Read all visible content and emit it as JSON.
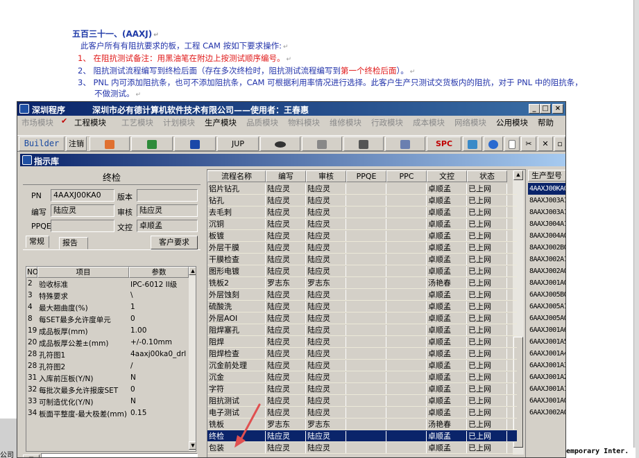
{
  "doc": {
    "heading": "五百三十一、(AAXJ)",
    "intro": "此客户所有有阻抗要求的板，工程 CAM 按如下要求操作:",
    "item1_prefix": "1、 在阻抗测试备注：",
    "item1_red": "用黑油笔在附边上按测试顺序编号。",
    "item2_prefix": "2、 阻抗测试流程编写到终检后面（存在多次终检时，阻抗测试流程编写到",
    "item2_red": "第一个终检后面",
    "item2_suffix": "）。",
    "item3": "3、 PNL 内可添加阻抗条，也可不添加阻抗条，CAM 可根据利用率情况进行选择。此客户生产只测试交货板内的阻抗，对于 PNL 中的阻抗条，",
    "item3_cont": "不做测试。"
  },
  "left_edge_text": "公司",
  "status_right": "emporary Inter.",
  "window": {
    "title": "深圳程序",
    "company": "深圳市必有德计算机软件技术有限公司——使用者：王春惠",
    "menus": [
      "市场模块",
      "工程模块",
      "工艺模块",
      "计划模块",
      "生产模块",
      "品质模块",
      "物料模块",
      "维修模块",
      "行政模块",
      "成本模块",
      "网络模块",
      "公用模块",
      "帮助"
    ],
    "toolbar": [
      "Builder",
      "注销",
      "JUP",
      "SPC"
    ]
  },
  "dialog": {
    "title": "指示库",
    "panel_title": "终检",
    "pn_label": "PN",
    "pn_value": "4AAXJ00KA0",
    "version_label": "版本",
    "version_value": "",
    "author_label": "编写",
    "author_value": "陆应灵",
    "reviewer_label": "审核",
    "reviewer_value": "陆应灵",
    "ppqe_label": "PPQE",
    "ppqe_value": "",
    "doc_ctrl_label": "文控",
    "doc_ctrl_value": "卓顺孟",
    "tabs": [
      "常规",
      "报告"
    ],
    "customer_btn": "客户要求",
    "params_headers": [
      "NO",
      "项目",
      "参数"
    ],
    "params": [
      {
        "no": "2",
        "item": "验收标准",
        "value": "IPC-6012 II级"
      },
      {
        "no": "3",
        "item": "特殊要求",
        "value": "\\"
      },
      {
        "no": "4",
        "item": "最大翘曲度(%)",
        "value": "1"
      },
      {
        "no": "8",
        "item": "每SET最多允许度单元",
        "value": "0"
      },
      {
        "no": "19",
        "item": "成品板厚(mm)",
        "value": "1.00"
      },
      {
        "no": "20",
        "item": "成品板厚公差±(mm)",
        "value": "+/-0.10mm"
      },
      {
        "no": "28",
        "item": "孔符图1",
        "value": "4aaxj00ka0_drl"
      },
      {
        "no": "28",
        "item": "孔符图2",
        "value": "/"
      },
      {
        "no": "31",
        "item": "入库前压板(Y/N)",
        "value": "N"
      },
      {
        "no": "32",
        "item": "每批次最多允许报废SET",
        "value": "0"
      },
      {
        "no": "33",
        "item": "可制造优化(Y/N)",
        "value": "N"
      },
      {
        "no": "34",
        "item": "板面平整度-最大极差(mm)",
        "value": "0.15"
      }
    ]
  },
  "flow": {
    "headers": [
      "流程名称",
      "编写",
      "审核",
      "PPQE",
      "PPC",
      "文控",
      "状态"
    ],
    "rows": [
      {
        "name": "铝片钻孔",
        "author": "陆应灵",
        "reviewer": "陆应灵",
        "ppqe": "",
        "ppc": "",
        "docctrl": "卓顺孟",
        "status": "已上网"
      },
      {
        "name": "钻孔",
        "author": "陆应灵",
        "reviewer": "陆应灵",
        "ppqe": "",
        "ppc": "",
        "docctrl": "卓顺孟",
        "status": "已上网"
      },
      {
        "name": "去毛刺",
        "author": "陆应灵",
        "reviewer": "陆应灵",
        "ppqe": "",
        "ppc": "",
        "docctrl": "卓顺孟",
        "status": "已上网"
      },
      {
        "name": "沉铜",
        "author": "陆应灵",
        "reviewer": "陆应灵",
        "ppqe": "",
        "ppc": "",
        "docctrl": "卓顺孟",
        "status": "已上网"
      },
      {
        "name": "板镀",
        "author": "陆应灵",
        "reviewer": "陆应灵",
        "ppqe": "",
        "ppc": "",
        "docctrl": "卓顺孟",
        "status": "已上网"
      },
      {
        "name": "外层干膜",
        "author": "陆应灵",
        "reviewer": "陆应灵",
        "ppqe": "",
        "ppc": "",
        "docctrl": "卓顺孟",
        "status": "已上网"
      },
      {
        "name": "干膜检查",
        "author": "陆应灵",
        "reviewer": "陆应灵",
        "ppqe": "",
        "ppc": "",
        "docctrl": "卓顺孟",
        "status": "已上网"
      },
      {
        "name": "图形电镀",
        "author": "陆应灵",
        "reviewer": "陆应灵",
        "ppqe": "",
        "ppc": "",
        "docctrl": "卓顺孟",
        "status": "已上网"
      },
      {
        "name": "铣板2",
        "author": "罗志东",
        "reviewer": "罗志东",
        "ppqe": "",
        "ppc": "",
        "docctrl": "汤艳春",
        "status": "已上网"
      },
      {
        "name": "外层蚀刻",
        "author": "陆应灵",
        "reviewer": "陆应灵",
        "ppqe": "",
        "ppc": "",
        "docctrl": "卓顺孟",
        "status": "已上网"
      },
      {
        "name": "硫酸洗",
        "author": "陆应灵",
        "reviewer": "陆应灵",
        "ppqe": "",
        "ppc": "",
        "docctrl": "卓顺孟",
        "status": "已上网"
      },
      {
        "name": "外层AOI",
        "author": "陆应灵",
        "reviewer": "陆应灵",
        "ppqe": "",
        "ppc": "",
        "docctrl": "卓顺孟",
        "status": "已上网"
      },
      {
        "name": "阻焊塞孔",
        "author": "陆应灵",
        "reviewer": "陆应灵",
        "ppqe": "",
        "ppc": "",
        "docctrl": "卓顺孟",
        "status": "已上网"
      },
      {
        "name": "阻焊",
        "author": "陆应灵",
        "reviewer": "陆应灵",
        "ppqe": "",
        "ppc": "",
        "docctrl": "卓顺孟",
        "status": "已上网"
      },
      {
        "name": "阻焊检查",
        "author": "陆应灵",
        "reviewer": "陆应灵",
        "ppqe": "",
        "ppc": "",
        "docctrl": "卓顺孟",
        "status": "已上网"
      },
      {
        "name": "沉金前处理",
        "author": "陆应灵",
        "reviewer": "陆应灵",
        "ppqe": "",
        "ppc": "",
        "docctrl": "卓顺孟",
        "status": "已上网"
      },
      {
        "name": "沉金",
        "author": "陆应灵",
        "reviewer": "陆应灵",
        "ppqe": "",
        "ppc": "",
        "docctrl": "卓顺孟",
        "status": "已上网"
      },
      {
        "name": "字符",
        "author": "陆应灵",
        "reviewer": "陆应灵",
        "ppqe": "",
        "ppc": "",
        "docctrl": "卓顺孟",
        "status": "已上网"
      },
      {
        "name": "阻抗测试",
        "author": "陆应灵",
        "reviewer": "陆应灵",
        "ppqe": "",
        "ppc": "",
        "docctrl": "卓顺孟",
        "status": "已上网"
      },
      {
        "name": "电子测试",
        "author": "陆应灵",
        "reviewer": "陆应灵",
        "ppqe": "",
        "ppc": "",
        "docctrl": "卓顺孟",
        "status": "已上网"
      },
      {
        "name": "铣板",
        "author": "罗志东",
        "reviewer": "罗志东",
        "ppqe": "",
        "ppc": "",
        "docctrl": "汤艳春",
        "status": "已上网"
      },
      {
        "name": "终检",
        "author": "陆应灵",
        "reviewer": "陆应灵",
        "ppqe": "",
        "ppc": "",
        "docctrl": "卓顺孟",
        "status": "已上网"
      },
      {
        "name": "包装",
        "author": "陆应灵",
        "reviewer": "陆应灵",
        "ppqe": "",
        "ppc": "",
        "docctrl": "卓顺孟",
        "status": "已上网"
      }
    ],
    "selected_index": 21
  },
  "production": {
    "header": "生产型号",
    "items": [
      "4AAXJ00KA0",
      "8AAXJ003A1",
      "8AAXJ003A1",
      "8AAXJ004A1",
      "8AAXJ004A0",
      "8AAXJ002B0",
      "8AAXJ002A1",
      "8AAXJ002A0",
      "8AAXJ001A0",
      "6AAXJ005B0",
      "6AAXJ005A1",
      "6AAXJ005A0",
      "6AAXJ001A6",
      "6AAXJ001A5",
      "6AAXJ001A4",
      "6AAXJ001A3",
      "6AAXJ001A2",
      "6AAXJ001A1",
      "6AAXJ001A0",
      "6AAXJ002A0"
    ],
    "selected_index": 0
  },
  "colors": {
    "title_start": "#0a246a",
    "title_end": "#3a6ea5",
    "selection": "#0a246a",
    "doc_blue": "#2233aa",
    "doc_red": "#e01818",
    "annotation_arrow": "#e05050"
  }
}
